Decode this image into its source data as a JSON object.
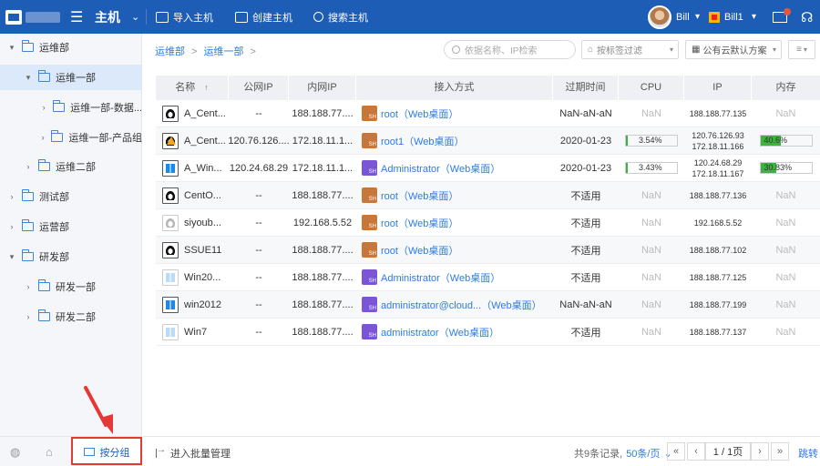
{
  "topbar": {
    "title": "主机",
    "actions": {
      "import": "导入主机",
      "create": "创建主机",
      "search": "搜索主机"
    },
    "user": "Bill",
    "account": "Bill1"
  },
  "sidebar": {
    "items": [
      {
        "label": "运维部"
      },
      {
        "label": "运维一部"
      },
      {
        "label": "运维一部-数据..."
      },
      {
        "label": "运维一部-产品组"
      },
      {
        "label": "运维二部"
      },
      {
        "label": "测试部"
      },
      {
        "label": "运营部"
      },
      {
        "label": "研发部"
      },
      {
        "label": "研发一部"
      },
      {
        "label": "研发二部"
      }
    ],
    "group_tab": "按分组"
  },
  "breadcrumb": {
    "level1": "运维部",
    "level2": "运维一部",
    "sep": ">"
  },
  "filters": {
    "search_placeholder": "依据名称、IP检索",
    "tag_placeholder": "按标签过滤",
    "cloud": "公有云默认方案"
  },
  "table": {
    "headers": {
      "name": "名称",
      "public_ip": "公网IP",
      "private_ip": "内网IP",
      "access": "接入方式",
      "expire": "过期时间",
      "cpu": "CPU",
      "ip": "IP",
      "mem": "内存"
    },
    "rows": [
      {
        "name": "A_Cent...",
        "os": "linux",
        "warn": false,
        "public_ip": "--",
        "private_ip": "188.188.77....",
        "access": "root（Web桌面）",
        "acc_type": "root",
        "expire": "NaN-aN-aN",
        "cpu": "NaN",
        "ip": "188.188.77.135",
        "mem": "NaN"
      },
      {
        "name": "A_Cent...",
        "os": "linux",
        "warn": true,
        "public_ip": "120.76.126....",
        "private_ip": "172.18.11.1...",
        "access": "root1（Web桌面）",
        "acc_type": "root",
        "expire": "2020-01-23",
        "cpu": "3.54%",
        "cpu_val": 0.0354,
        "ip": "120.76.126.93",
        "ip2": "172.18.11.166",
        "mem": "40.6%",
        "mem_val": 0.406
      },
      {
        "name": "A_Win...",
        "os": "win",
        "warn": false,
        "public_ip": "120.24.68.29",
        "private_ip": "172.18.11.1...",
        "access": "Administrator（Web桌面）",
        "acc_type": "admin",
        "expire": "2020-01-23",
        "cpu": "3.43%",
        "cpu_val": 0.0343,
        "ip": "120.24.68.29",
        "ip2": "172.18.11.167",
        "mem": "30.83%",
        "mem_val": 0.3083
      },
      {
        "name": "CentO...",
        "os": "linux",
        "warn": false,
        "public_ip": "--",
        "private_ip": "188.188.77....",
        "access": "root（Web桌面）",
        "acc_type": "root",
        "expire": "不适用",
        "cpu": "NaN",
        "ip": "188.188.77.136",
        "mem": "NaN"
      },
      {
        "name": "siyoub...",
        "os": "linux-off",
        "warn": false,
        "public_ip": "--",
        "private_ip": "192.168.5.52",
        "access": "root（Web桌面）",
        "acc_type": "root",
        "expire": "不适用",
        "cpu": "NaN",
        "ip": "192.168.5.52",
        "mem": "NaN"
      },
      {
        "name": "SSUE11",
        "os": "linux",
        "warn": false,
        "public_ip": "--",
        "private_ip": "188.188.77....",
        "access": "root（Web桌面）",
        "acc_type": "root",
        "expire": "不适用",
        "cpu": "NaN",
        "ip": "188.188.77.102",
        "mem": "NaN"
      },
      {
        "name": "Win20...",
        "os": "win-off",
        "warn": false,
        "public_ip": "--",
        "private_ip": "188.188.77....",
        "access": "Administrator（Web桌面）",
        "acc_type": "admin",
        "expire": "不适用",
        "cpu": "NaN",
        "ip": "188.188.77.125",
        "mem": "NaN"
      },
      {
        "name": "win2012",
        "os": "win",
        "warn": false,
        "public_ip": "--",
        "private_ip": "188.188.77....",
        "access": "administrator@cloud...（Web桌面）",
        "acc_type": "admin",
        "expire": "NaN-aN-aN",
        "cpu": "NaN",
        "ip": "188.188.77.199",
        "mem": "NaN"
      },
      {
        "name": "Win7",
        "os": "win-off",
        "warn": false,
        "public_ip": "--",
        "private_ip": "188.188.77....",
        "access": "administrator（Web桌面）",
        "acc_type": "admin",
        "expire": "不适用",
        "cpu": "NaN",
        "ip": "188.188.77.137",
        "mem": "NaN"
      }
    ]
  },
  "footer": {
    "batch": "进入批量管理",
    "total": "共9条记录,",
    "page_size": "50条/页",
    "page": "1 / 1页",
    "jump": "跳转"
  }
}
